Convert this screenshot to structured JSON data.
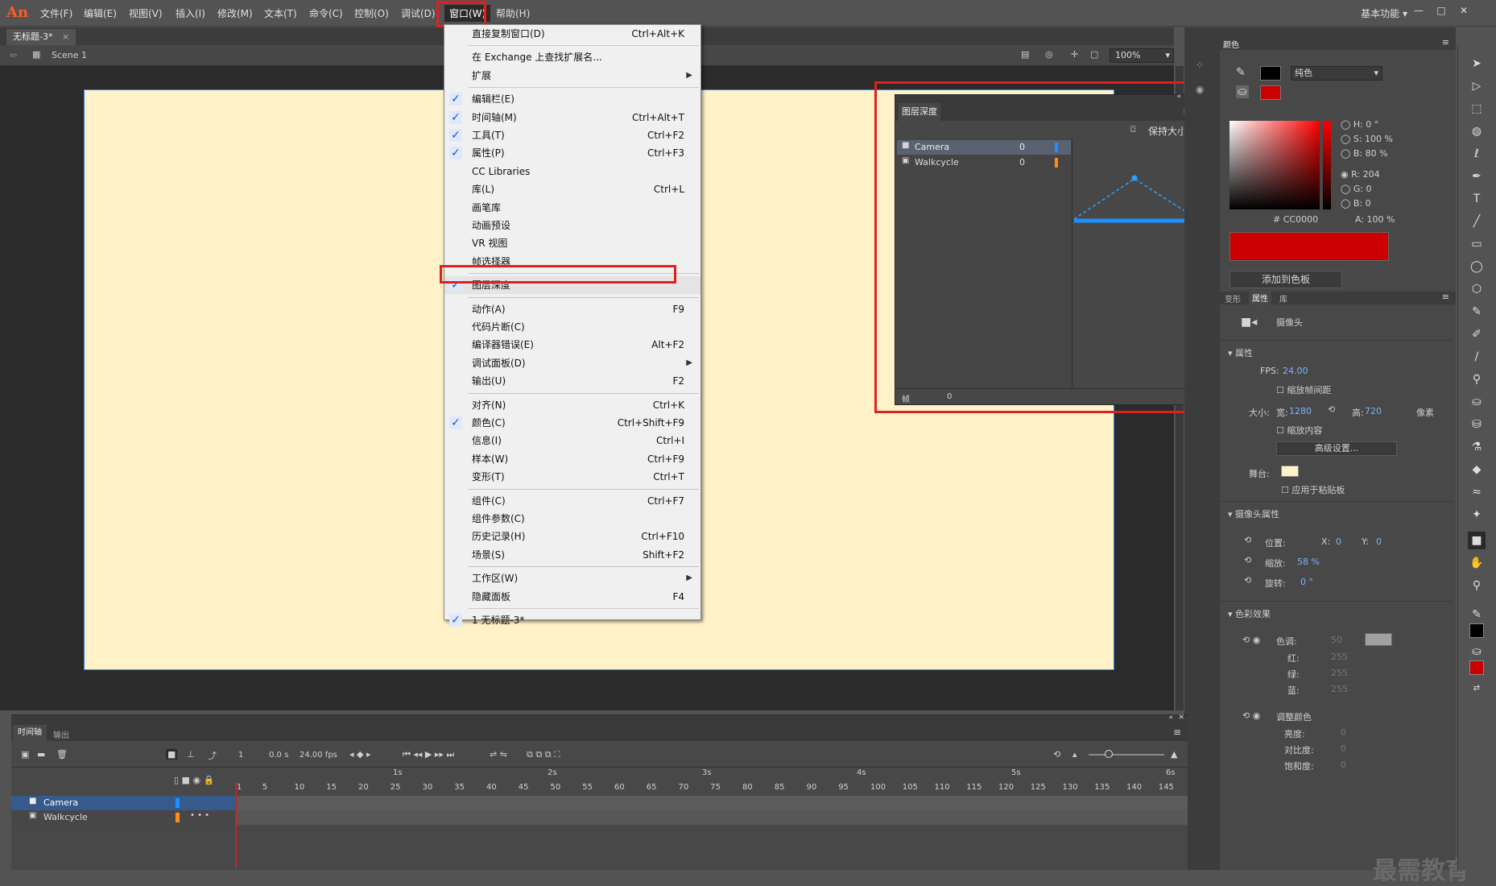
{
  "app": {
    "logo": "An",
    "workspace": "基本功能"
  },
  "menubar": {
    "items": [
      "文件(F)",
      "编辑(E)",
      "视图(V)",
      "插入(I)",
      "修改(M)",
      "文本(T)",
      "命令(C)",
      "控制(O)",
      "调试(D)",
      "窗口(W)",
      "帮助(H)"
    ]
  },
  "document": {
    "tab": "无标题-3*",
    "scene": "Scene 1",
    "zoom": "100%"
  },
  "window_menu": {
    "rows": [
      {
        "label": "直接复制窗口(D)",
        "shortcut": "Ctrl+Alt+K",
        "checked": false,
        "submenu": false
      },
      {
        "label": "在 Exchange 上查找扩展名...",
        "shortcut": "",
        "checked": false,
        "submenu": false
      },
      {
        "label": "扩展",
        "shortcut": "",
        "checked": false,
        "submenu": true
      },
      {
        "label": "编辑栏(E)",
        "shortcut": "",
        "checked": true,
        "submenu": false
      },
      {
        "label": "时间轴(M)",
        "shortcut": "Ctrl+Alt+T",
        "checked": true,
        "submenu": false
      },
      {
        "label": "工具(T)",
        "shortcut": "Ctrl+F2",
        "checked": true,
        "submenu": false
      },
      {
        "label": "属性(P)",
        "shortcut": "Ctrl+F3",
        "checked": true,
        "submenu": false
      },
      {
        "label": "CC Libraries",
        "shortcut": "",
        "checked": false,
        "submenu": false
      },
      {
        "label": "库(L)",
        "shortcut": "Ctrl+L",
        "checked": false,
        "submenu": false
      },
      {
        "label": "画笔库",
        "shortcut": "",
        "checked": false,
        "submenu": false
      },
      {
        "label": "动画预设",
        "shortcut": "",
        "checked": false,
        "submenu": false
      },
      {
        "label": "VR 视图",
        "shortcut": "",
        "checked": false,
        "submenu": false
      },
      {
        "label": "帧选择器",
        "shortcut": "",
        "checked": false,
        "submenu": false
      },
      {
        "label": "图层深度",
        "shortcut": "",
        "checked": true,
        "submenu": false
      },
      {
        "label": "动作(A)",
        "shortcut": "F9",
        "checked": false,
        "submenu": false
      },
      {
        "label": "代码片断(C)",
        "shortcut": "",
        "checked": false,
        "submenu": false
      },
      {
        "label": "编译器错误(E)",
        "shortcut": "Alt+F2",
        "checked": false,
        "submenu": false
      },
      {
        "label": "调试面板(D)",
        "shortcut": "",
        "checked": false,
        "submenu": true
      },
      {
        "label": "输出(U)",
        "shortcut": "F2",
        "checked": false,
        "submenu": false
      },
      {
        "label": "对齐(N)",
        "shortcut": "Ctrl+K",
        "checked": false,
        "submenu": false
      },
      {
        "label": "颜色(C)",
        "shortcut": "Ctrl+Shift+F9",
        "checked": true,
        "submenu": false
      },
      {
        "label": "信息(I)",
        "shortcut": "Ctrl+I",
        "checked": false,
        "submenu": false
      },
      {
        "label": "样本(W)",
        "shortcut": "Ctrl+F9",
        "checked": false,
        "submenu": false
      },
      {
        "label": "变形(T)",
        "shortcut": "Ctrl+T",
        "checked": false,
        "submenu": false
      },
      {
        "label": "组件(C)",
        "shortcut": "Ctrl+F7",
        "checked": false,
        "submenu": false
      },
      {
        "label": "组件参数(C)",
        "shortcut": "",
        "checked": false,
        "submenu": false
      },
      {
        "label": "历史记录(H)",
        "shortcut": "Ctrl+F10",
        "checked": false,
        "submenu": false
      },
      {
        "label": "场景(S)",
        "shortcut": "Shift+F2",
        "checked": false,
        "submenu": false
      },
      {
        "label": "工作区(W)",
        "shortcut": "",
        "checked": false,
        "submenu": true
      },
      {
        "label": "隐藏面板",
        "shortcut": "F4",
        "checked": false,
        "submenu": false
      },
      {
        "label": "1 无标题-3*",
        "shortcut": "",
        "checked": true,
        "submenu": false
      }
    ]
  },
  "depth_panel": {
    "title": "图层深度",
    "keep_size": "保持大小",
    "layers": [
      {
        "name": "Camera",
        "depth": "0",
        "color": "#1e90ff"
      },
      {
        "name": "Walkcycle",
        "depth": "0",
        "color": "#ff8c1a"
      }
    ],
    "frame_label": "帧",
    "frame_value": "0"
  },
  "color_panel": {
    "tab": "颜色",
    "fill_type": "纯色",
    "h_label": "H:",
    "h": "0 °",
    "s_label": "S:",
    "s": "100 %",
    "b_label": "B:",
    "b": "80 %",
    "r_label": "R:",
    "r": "204",
    "g_label": "G:",
    "g": "0",
    "bl_label": "B:",
    "bl": "0",
    "hex_label": "#",
    "hex": "CC0000",
    "a_label": "A:",
    "a": "100 %",
    "swatch": "#cc0000",
    "add_button": "添加到色板"
  },
  "properties_panel": {
    "tabs": [
      "变形",
      "属性",
      "库"
    ],
    "object": "摄像头",
    "sec_props": "属性",
    "fps_label": "FPS:",
    "fps": "24.00",
    "scale_spans": "缩放帧间距",
    "size_label": "大小:",
    "w_label": "宽:",
    "w": "1280",
    "h_label": "高:",
    "h": "720",
    "unit": "像素",
    "scale_content": "缩放内容",
    "advanced": "高级设置...",
    "stage_label": "舞台:",
    "stage_color": "#fff2c8",
    "apply_paste": "应用于粘贴板",
    "sec_camera": "摄像头属性",
    "pos_label": "位置:",
    "x_label": "X:",
    "x": "0",
    "y_label": "Y:",
    "y": "0",
    "zoom_label": "缩放:",
    "zoom": "58 %",
    "rot_label": "旋转:",
    "rot": "0 °",
    "sec_color": "色彩效果",
    "tint_label": "色调:",
    "tint": "50",
    "red_label": "红:",
    "red": "255",
    "green_label": "绿:",
    "green": "255",
    "blue_label": "蓝:",
    "blue": "255",
    "adjust_label": "调整颜色",
    "bright_label": "亮度:",
    "bright": "0",
    "contrast_label": "对比度:",
    "contrast": "0",
    "sat_label": "饱和度:",
    "sat": "0"
  },
  "timeline": {
    "tabs": [
      "时间轴",
      "输出"
    ],
    "frame": "1",
    "time": "0.0 s",
    "fps": "24.00 fps",
    "layers": [
      {
        "name": "Camera"
      },
      {
        "name": "Walkcycle"
      }
    ],
    "seconds": [
      "1s",
      "2s",
      "3s",
      "4s",
      "5s",
      "6s"
    ],
    "ticks": [
      "1",
      "5",
      "10",
      "15",
      "20",
      "25",
      "30",
      "35",
      "40",
      "45",
      "50",
      "55",
      "60",
      "65",
      "70",
      "75",
      "80",
      "85",
      "90",
      "95",
      "100",
      "105",
      "110",
      "115",
      "120",
      "125",
      "130",
      "135",
      "140",
      "145"
    ]
  },
  "watermark": "最需教育"
}
